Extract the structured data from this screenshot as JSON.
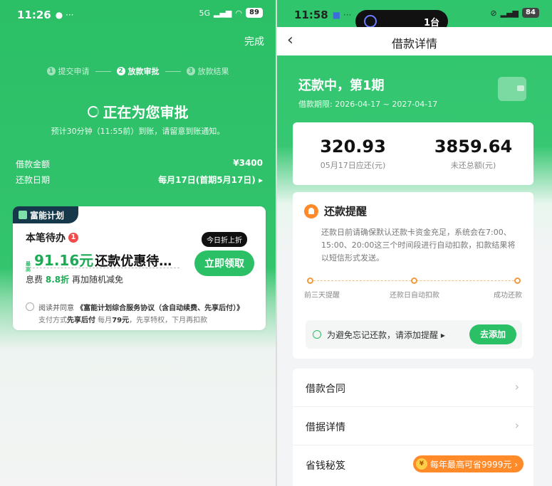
{
  "left": {
    "status": {
      "time": "11:26",
      "battery": "89",
      "net": "5G"
    },
    "done_label": "完成",
    "steps": [
      {
        "num": "1",
        "label": "提交申请"
      },
      {
        "num": "2",
        "label": "放款审批"
      },
      {
        "num": "3",
        "label": "放款结果"
      }
    ],
    "approve_title": "正在为您审批",
    "eta": "预计30分钟（11:55前）到账，请留意到账通知。",
    "loan_amount_label": "借款金额",
    "loan_amount_value": "¥3400",
    "repay_date_label": "还款日期",
    "repay_date_value": "每月17日(首期5月17日) ▸",
    "card": {
      "brand": "富能计划",
      "todo": "本笔待办",
      "todo_count": "1",
      "offer_prefix": "最高",
      "offer_amount": "91.16元",
      "offer_text": "还款优惠待…",
      "fee_prefix": "息费",
      "fee_discount": "8.8折",
      "fee_suffix": " 再加随机减免",
      "claim_button": "立即领取",
      "bubble": "今日折上折",
      "agree_prefix": "阅读并同意",
      "agree_doc": "《富能计划综合服务协议（含自动续费、先享后付）》",
      "agree_sub_prefix": "支付方式",
      "agree_sub_bold": "先享后付",
      "agree_sub_mid": " 每月",
      "agree_sub_price": "79元",
      "agree_sub_suffix": "，先享特权，下月再扣款"
    }
  },
  "right": {
    "status": {
      "time": "11:58",
      "battery": "84",
      "island_text": "1台"
    },
    "nav_title": "借款详情",
    "repay_title": "还款中，第1期",
    "term": "借款期限: 2026-04-17 ~ 2027-04-17",
    "amounts": [
      {
        "value": "320.93",
        "label": "05月17日应还(元)"
      },
      {
        "value": "3859.64",
        "label": "未还总额(元)"
      }
    ],
    "reminder": {
      "title": "还款提醒",
      "text": "还款日前请确保默认还款卡资金充足，系统会在7:00、15:00、20:00这三个时间段进行自动扣款，扣款结果将以短信形式发送。",
      "stages": [
        "前三天提醒",
        "还款日自动扣款",
        "成功还款"
      ],
      "add_text": "为避免忘记还款，请添加提醒 ▸",
      "add_button": "去添加"
    },
    "menu": [
      {
        "label": "借款合同"
      },
      {
        "label": "借据详情"
      },
      {
        "label": "省钱秘笈",
        "badge": "每年最高可省9999元 ›"
      }
    ],
    "accent": "#2bbf66"
  }
}
